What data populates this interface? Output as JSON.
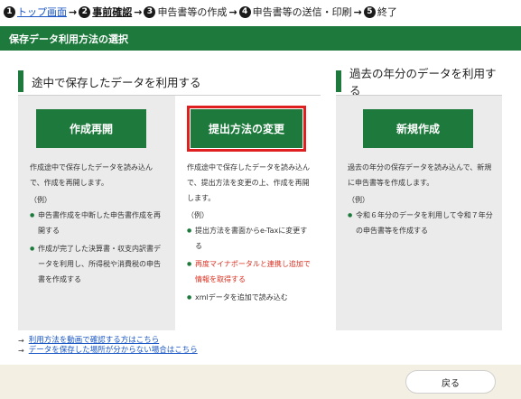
{
  "breadcrumb": {
    "steps": [
      {
        "num": "1",
        "label": "トップ画面"
      },
      {
        "num": "2",
        "label": "事前確認"
      },
      {
        "num": "3",
        "label": "申告書等の作成"
      },
      {
        "num": "4",
        "label": "申告書等の送信・印刷"
      },
      {
        "num": "5",
        "label": "終了"
      }
    ],
    "arrow": "→"
  },
  "page_title": "保存データ利用方法の選択",
  "left_section": {
    "heading": "途中で保存したデータを利用する",
    "cards": [
      {
        "button": "作成再開",
        "description": "作成途中で保存したデータを読み込んで、作成を再開します。",
        "example_label": "（例）",
        "items": [
          "申告書作成を中断した申告書作成を再開する",
          "作成が完了した決算書・収支内訳書データを利用し、所得税や消費税の申告書を作成する"
        ]
      },
      {
        "button": "提出方法の変更",
        "description": "作成途中で保存したデータを読み込んで、提出方法を変更の上、作成を再開します。",
        "example_label": "（例）",
        "items": [
          "提出方法を書面からe-Taxに変更する",
          "再度マイナポータルと連携し追加で情報を取得する",
          "xmlデータを追加で読み込む"
        ]
      }
    ]
  },
  "right_section": {
    "heading": "過去の年分のデータを利用する",
    "card": {
      "button": "新規作成",
      "description": "過去の年分の保存データを読み込んで、新規に申告書等を作成します。",
      "example_label": "（例）",
      "items": [
        "令和６年分のデータを利用して令和７年分の申告書等を作成する"
      ]
    }
  },
  "links": [
    {
      "arrow": "→",
      "label": "利用方法を動画で確認する方はこちら"
    },
    {
      "arrow": "→",
      "label": "データを保存した場所が分からない場合はこちら"
    }
  ],
  "footer": {
    "back_label": "戻る"
  },
  "colors": {
    "primary_green": "#1e7a3c",
    "highlight_red": "#e02020",
    "link_blue": "#1a56c4"
  }
}
